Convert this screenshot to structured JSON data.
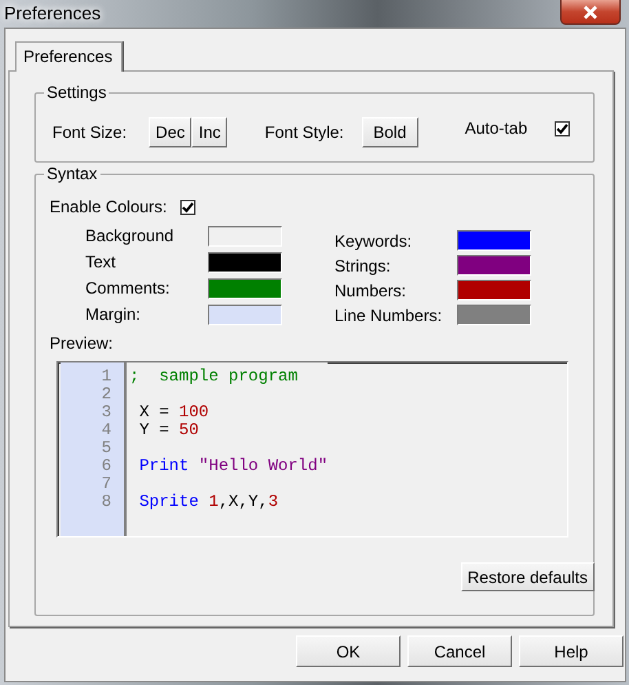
{
  "window": {
    "title": "Preferences"
  },
  "tabs": [
    {
      "label": "Preferences",
      "selected": true
    }
  ],
  "settings": {
    "title": "Settings",
    "font_size_label": "Font Size:",
    "dec_button": "Dec",
    "inc_button": "Inc",
    "font_style_label": "Font Style:",
    "bold_button": "Bold",
    "auto_tab": {
      "label": "Auto-tab",
      "checked": true
    }
  },
  "syntax": {
    "title": "Syntax",
    "enable_colours": {
      "label": "Enable Colours:",
      "checked": true
    },
    "colours_left": [
      {
        "label": "Background",
        "kind": "background",
        "color": "#f0f0f0"
      },
      {
        "label": "Text",
        "kind": "text",
        "color": "#000000"
      },
      {
        "label": "Comments:",
        "kind": "comment",
        "color": "#008000"
      },
      {
        "label": "Margin:",
        "kind": "margin",
        "color": "#d8e0f8"
      }
    ],
    "colours_right": [
      {
        "label": "Keywords:",
        "kind": "keyword",
        "color": "#0000ff"
      },
      {
        "label": "Strings:",
        "kind": "string",
        "color": "#800080"
      },
      {
        "label": "Numbers:",
        "kind": "number",
        "color": "#b00000"
      },
      {
        "label": "Line Numbers:",
        "kind": "linenumber",
        "color": "#808080"
      }
    ],
    "preview_label": "Preview:",
    "preview": [
      {
        "number": "1",
        "tokens": [
          {
            "kind": "comment",
            "text": ";  sample program"
          }
        ]
      },
      {
        "number": "2"
      },
      {
        "number": "3",
        "tokens": [
          {
            "kind": "text",
            "text": " X = "
          },
          {
            "kind": "number",
            "text": "100"
          }
        ]
      },
      {
        "number": "4",
        "tokens": [
          {
            "kind": "text",
            "text": " Y = "
          },
          {
            "kind": "number",
            "text": "50"
          }
        ]
      },
      {
        "number": "5"
      },
      {
        "number": "6",
        "tokens": [
          {
            "kind": "keyword",
            "text": " Print "
          },
          {
            "kind": "string",
            "text": "\"Hello World\""
          }
        ]
      },
      {
        "number": "7"
      },
      {
        "number": "8",
        "tokens": [
          {
            "kind": "keyword",
            "text": " Sprite "
          },
          {
            "kind": "number",
            "text": "1"
          },
          {
            "kind": "text",
            "text": ",X,Y,"
          },
          {
            "kind": "number",
            "text": "3"
          }
        ]
      }
    ],
    "restore_button": "Restore defaults"
  },
  "buttons": [
    "OK",
    "Cancel",
    "Help"
  ]
}
